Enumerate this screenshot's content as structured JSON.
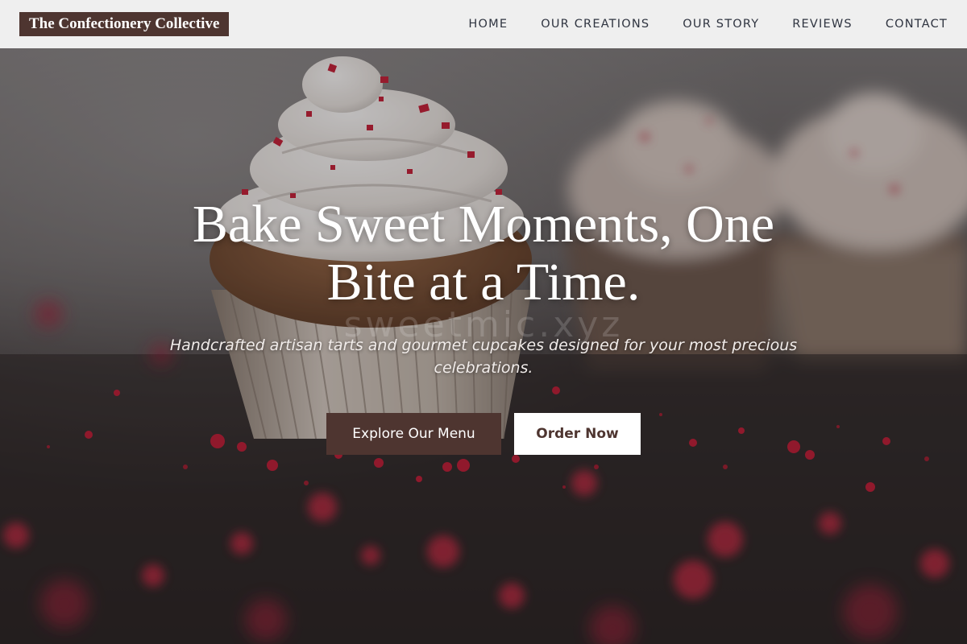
{
  "header": {
    "brand": "The Confectionery Collective",
    "nav": [
      {
        "label": "HOME"
      },
      {
        "label": "OUR CREATIONS"
      },
      {
        "label": "OUR STORY"
      },
      {
        "label": "REVIEWS"
      },
      {
        "label": "CONTACT"
      }
    ]
  },
  "hero": {
    "title": "Bake Sweet Moments, One Bite at a Time.",
    "subtitle": "Handcrafted artisan tarts and gourmet cupcakes designed for your most precious celebrations.",
    "watermark": "sweetmic.xyz",
    "primary_button": "Explore Our Menu",
    "secondary_button": "Order Now"
  },
  "colors": {
    "brand": "#4e3530",
    "header_bg": "#efefef",
    "nav_text": "#2f3440",
    "sprinkle": "#c8203a",
    "frosting": "#f4f1ee"
  }
}
